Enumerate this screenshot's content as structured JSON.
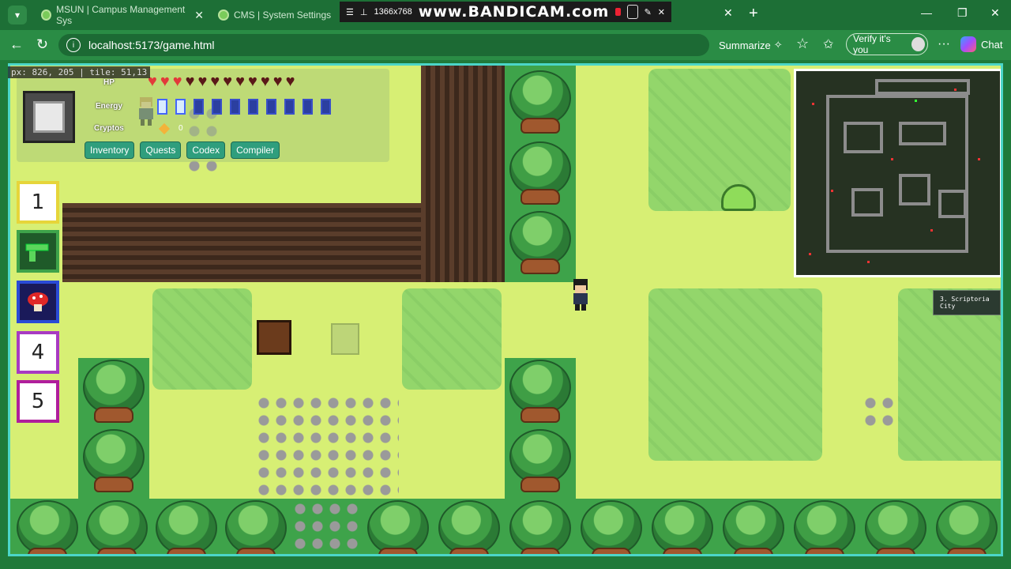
{
  "browser": {
    "tabs": [
      {
        "title": "MSUN | Campus Management Sys"
      },
      {
        "title": "CMS | System Settings"
      }
    ],
    "url": "localhost:5173/game.html",
    "summarize_label": "Summarize",
    "verify_label": "Verify it's you",
    "chat_label": "Chat"
  },
  "recorder": {
    "brand": "www.BANDICAM.com",
    "resolution": "1366x768"
  },
  "game": {
    "debug_coords": "px: 826, 205 | tile: 51,13",
    "hud": {
      "hp_label": "HP",
      "energy_label": "Energy",
      "cryptos_label": "Cryptos",
      "hp_full": 3,
      "hp_total": 12,
      "energy_full": 2,
      "energy_total": 10,
      "cryptos_value": "0",
      "buttons": [
        "Inventory",
        "Quests",
        "Codex",
        "Compiler"
      ]
    },
    "hotbar": [
      {
        "label": "1",
        "border": "#e6d53a"
      },
      {
        "label": "",
        "border": "#3ea34a",
        "icon": "pistol-icon"
      },
      {
        "label": "",
        "border": "#2a4bd6",
        "icon": "mushroom-icon"
      },
      {
        "label": "4",
        "border": "#a83ac2"
      },
      {
        "label": "5",
        "border": "#b01e9c"
      }
    ],
    "region_label": "3. Scriptoria City"
  }
}
